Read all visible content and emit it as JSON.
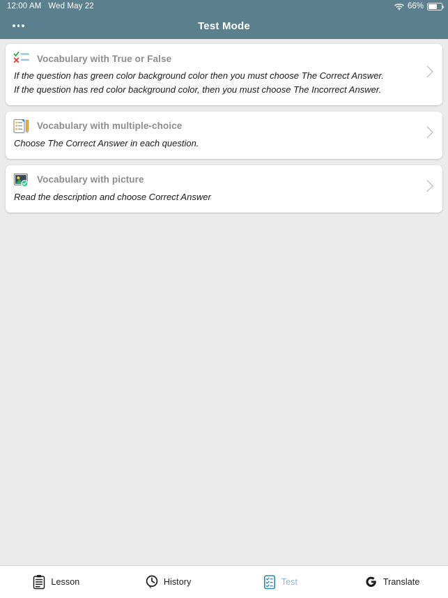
{
  "status_bar": {
    "time": "12:00 AM",
    "date": "Wed May 22",
    "wifi_icon": "wifi-icon",
    "battery_percent": "66%",
    "battery_icon": "battery-icon"
  },
  "nav": {
    "more_icon": "more-options-icon",
    "title": "Test Mode",
    "background_color": "#5b7f8c"
  },
  "cards": [
    {
      "icon": "true-false-checklist-icon",
      "title": "Vocabulary with True or False",
      "description_line1": "If the question has green color background color then you must choose The Correct Answer.",
      "description_line2": "If the question has red color background color, then you must choose The Incorrect Answer.",
      "chevron_icon": "chevron-right-icon"
    },
    {
      "icon": "clipboard-pencil-icon",
      "title": "Vocabulary with multiple-choice",
      "description_line1": "Choose The Correct Answer in each question.",
      "description_line2": "",
      "chevron_icon": "chevron-right-icon"
    },
    {
      "icon": "picture-check-icon",
      "title": "Vocabulary with picture",
      "description_line1": "Read the description and choose Correct Answer",
      "description_line2": "",
      "chevron_icon": "chevron-right-icon"
    }
  ],
  "tab_bar": {
    "items": [
      {
        "icon": "clipboard-lesson-icon",
        "label": "Lesson",
        "active": false
      },
      {
        "icon": "clock-history-icon",
        "label": "History",
        "active": false
      },
      {
        "icon": "test-checklist-icon",
        "label": "Test",
        "active": true
      },
      {
        "icon": "google-translate-icon",
        "label": "Translate",
        "active": false
      }
    ],
    "active_color": "#8fb6c9",
    "inactive_color": "#1c1c1c"
  },
  "colors": {
    "page_background": "#ebebeb",
    "card_background": "#ffffff",
    "header": "#5b7f8c",
    "card_title": "#8c8c8c"
  }
}
